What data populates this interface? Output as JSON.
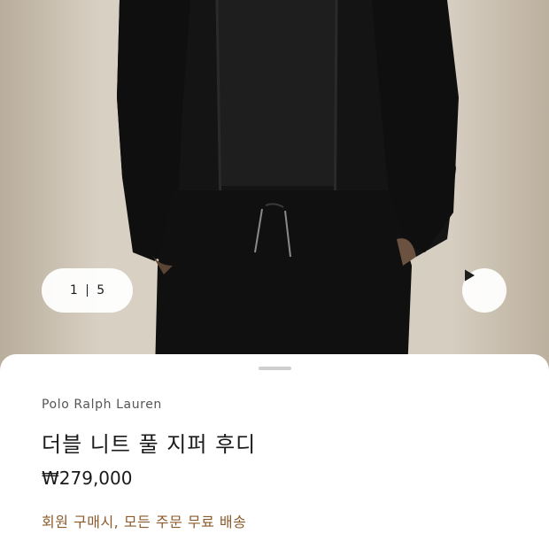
{
  "gallery": {
    "current_index": "1",
    "total": "5",
    "image_description_icon": "product-photo-icon",
    "play_icon": "play-icon"
  },
  "product": {
    "brand": "Polo Ralph Lauren",
    "name": "더블 니트 풀 지퍼 후디",
    "price": "₩279,000",
    "shipping_note": "회원 구매시, 모든 주문 무료 배송"
  },
  "colors": {
    "accent_shipping": "#8b5a2b",
    "text_primary": "#1b1b1b",
    "background": "#ffffff"
  }
}
